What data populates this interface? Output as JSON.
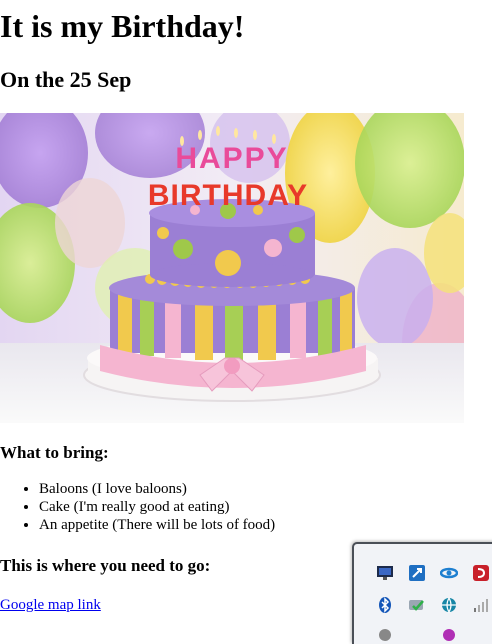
{
  "page": {
    "title": "It is my Birthday!",
    "date_line": "On the 25 Sep"
  },
  "hero_image": {
    "cake_text_top": "HAPPY",
    "cake_text_bottom": "BIRTHDAY",
    "colors": {
      "balloon_purple": "#b68fe0",
      "balloon_yellow": "#f4dd5a",
      "balloon_green": "#b8e06a",
      "cake_purple": "#9b7fd4",
      "frosting_pink": "#f5b5d0",
      "stripe_yellow": "#f1c94d",
      "stripe_green": "#a7cf55",
      "dot_green": "#9fc84a"
    }
  },
  "bring_section": {
    "heading": "What to bring:",
    "items": [
      "Baloons (I love baloons)",
      "Cake (I'm really good at eating)",
      "An appetite (There will be lots of food)"
    ]
  },
  "location_section": {
    "heading": "This is where you need to go:",
    "link_text": "Google map link"
  },
  "system_tray": {
    "icons": [
      "display-icon",
      "remote-tool-icon",
      "sync-icon",
      "security-shield-icon",
      "bluetooth-icon",
      "sync-check-icon",
      "network-globe-icon",
      "signal-bars-icon",
      "app-icon",
      "media-icon"
    ]
  }
}
